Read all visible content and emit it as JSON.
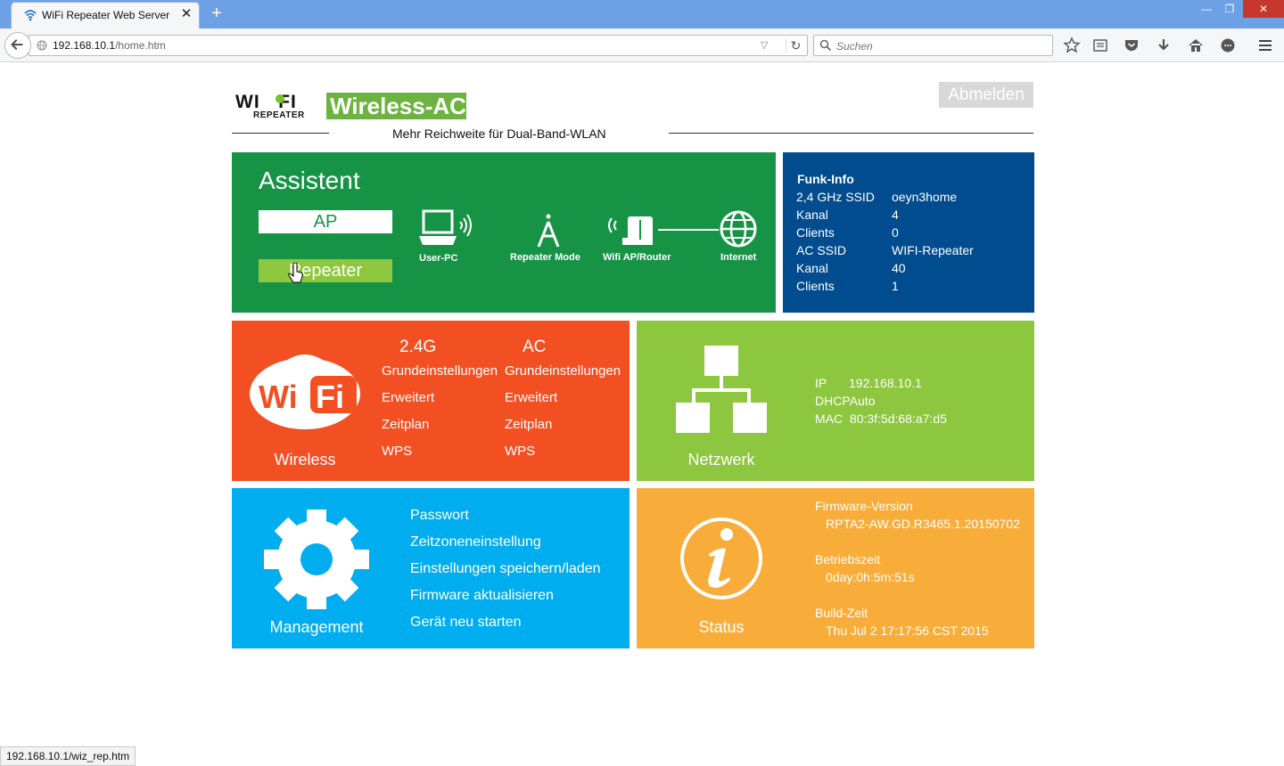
{
  "browser": {
    "tab_title": "WiFi Repeater Web Server",
    "tab_close": "✕",
    "new_tab": "+",
    "url_host": "192.168.10.1",
    "url_path": "/home.htm",
    "search_placeholder": "Suchen",
    "status_url": "192.168.10.1/wiz_rep.htm"
  },
  "header": {
    "logo_wifi": "WI   FI",
    "logo_repeater": "REPEATER",
    "logo_ac": "Wireless-AC",
    "subtitle": "Mehr Reichweite für Dual-Band-WLAN",
    "logout": "Abmelden"
  },
  "assistant": {
    "title": "Assistent",
    "ap_button": "AP",
    "repeater_button": "Repeater",
    "diagram": {
      "user_pc": "User-PC",
      "repeater_mode": "Repeater Mode",
      "wifi_router": "Wifi AP/Router",
      "internet": "Internet"
    }
  },
  "funk_info": {
    "title": "Funk-Info",
    "rows": [
      {
        "label": "2,4 GHz SSID",
        "value": "oeyn3home"
      },
      {
        "label": "Kanal",
        "value": "4"
      },
      {
        "label": "Clients",
        "value": "0"
      },
      {
        "label": "AC SSID",
        "value": "WIFI-Repeater"
      },
      {
        "label": "Kanal",
        "value": "40"
      },
      {
        "label": "Clients",
        "value": "1"
      }
    ]
  },
  "wireless": {
    "label": "Wireless",
    "logo_text": "Wi Fi",
    "col24": {
      "title": "2.4G",
      "links": [
        "Grundeinstellungen",
        "Erweitert",
        "Zeitplan",
        "WPS"
      ]
    },
    "colac": {
      "title": "AC",
      "links": [
        "Grundeinstellungen",
        "Erweitert",
        "Zeitplan",
        "WPS"
      ]
    }
  },
  "network": {
    "label": "Netzwerk",
    "ip_label": "IP",
    "ip_value": "192.168.10.1",
    "dhcp_label": "DHCP",
    "dhcp_value": "Auto",
    "mac_label": "MAC",
    "mac_value": "80:3f:5d:68:a7:d5"
  },
  "management": {
    "label": "Management",
    "links": [
      "Passwort",
      "Zeitzoneneinstellung",
      "Einstellungen speichern/laden",
      "Firmware aktualisieren",
      "Gerät neu starten"
    ]
  },
  "status": {
    "label": "Status",
    "firmware_label": "Firmware-Version",
    "firmware_value": "RPTA2-AW.GD.R3465.1.20150702",
    "uptime_label": "Betriebszeit",
    "uptime_value": "0day:0h:5m:51s",
    "build_label": "Build-Zeit",
    "build_value": "Thu Jul 2 17:17:56 CST 2015"
  },
  "colors": {
    "assistant_green": "#179346",
    "funk_blue": "#014c8e",
    "wireless_red": "#f25022",
    "network_green": "#8dc63f",
    "management_blue": "#00adef",
    "status_orange": "#f8ad3b"
  }
}
